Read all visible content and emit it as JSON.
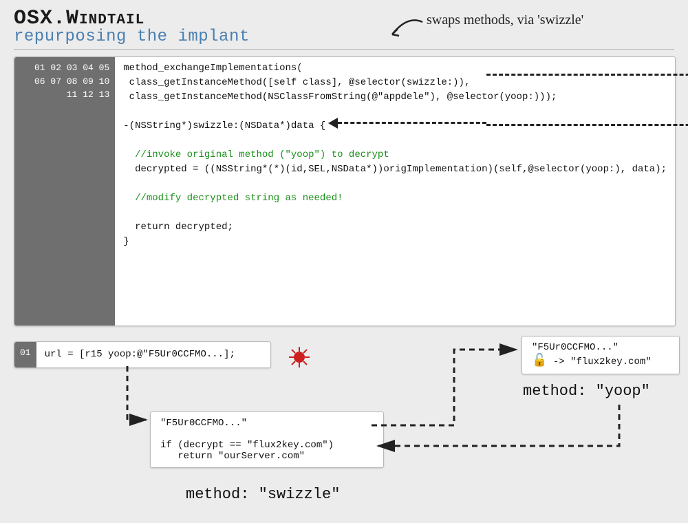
{
  "header": {
    "title": "OSX.Windtail",
    "subtitle": "repurposing the implant",
    "annotation": "swaps methods, via 'swizzle'"
  },
  "code1": {
    "lines": [
      "01",
      "02",
      "03",
      "04",
      "05",
      "06",
      "07",
      "08",
      "09",
      "10",
      "11",
      "12",
      "13"
    ],
    "l1": "method_exchangeImplementations(",
    "l2": " class_getInstanceMethod([self class], @selector(swizzle:)),",
    "l3": " class_getInstanceMethod(NSClassFromString(@\"appdele\"), @selector(yoop:)));",
    "l4": "",
    "l5": "-(NSString*)swizzle:(NSData*)data {",
    "l6": "",
    "l7": "  //invoke original method (\"yoop\") to decrypt",
    "l8": "  decrypted = ((NSString*(*)(id,SEL,NSData*))origImplementation)(self,@selector(yoop:), data);",
    "l9": "",
    "l10": "  //modify decrypted string as needed!",
    "l11": "",
    "l12": "  return decrypted;",
    "l13": "}"
  },
  "code2": {
    "lines": [
      "01"
    ],
    "l1": "url = [r15 yoop:@\"F5Ur0CCFMO...];"
  },
  "swizzle_box": {
    "header": "\"F5Ur0CCFMO...\"",
    "body1": "if (decrypt == \"flux2key.com\")",
    "body2": "   return \"ourServer.com\""
  },
  "yoop_box": {
    "header": "\"F5Ur0CCFMO...\"",
    "arrow": "->",
    "result": "\"flux2key.com\""
  },
  "labels": {
    "method_swizzle": "method:  \"swizzle\"",
    "method_yoop": "method:  \"yoop\""
  }
}
